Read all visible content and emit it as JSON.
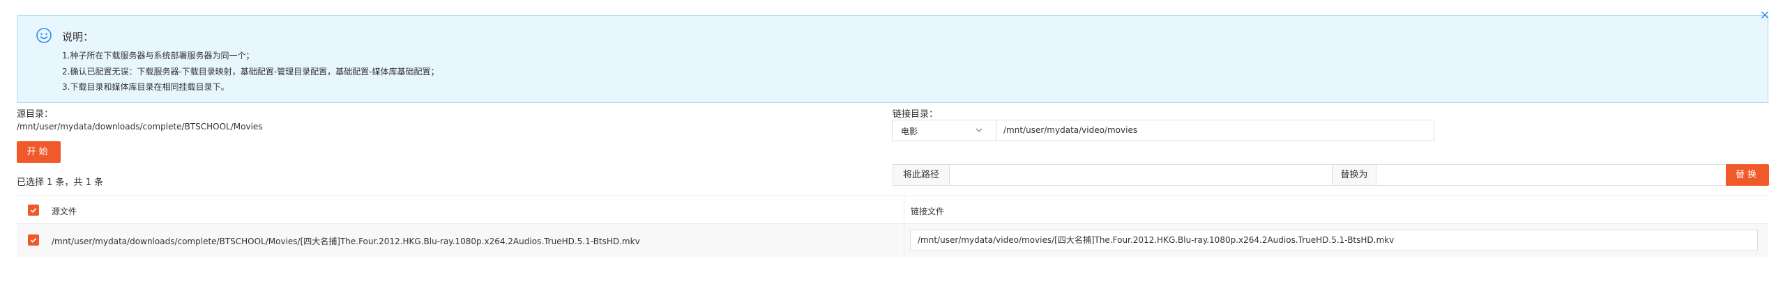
{
  "notice": {
    "title": "说明：",
    "lines": [
      "1.种子所在下载服务器与系统部署服务器为同一个；",
      "2.确认已配置无误：下载服务器-下载目录映射，基础配置-管理目录配置，基础配置-媒体库基础配置；",
      "3.下载目录和媒体库目录在相同挂载目录下。"
    ],
    "close_glyph": "×",
    "icon": "smile-icon",
    "accent_color": "#2d8cf0"
  },
  "source": {
    "label": "源目录：",
    "path": "/mnt/user/mydata/downloads/complete/BTSCHOOL/Movies"
  },
  "start_button": "开始",
  "selection_summary": "已选择 1 条，共 1 条",
  "link": {
    "label": "链接目录：",
    "type_selected": "电影",
    "path": "/mnt/user/mydata/video/movies"
  },
  "replace": {
    "path_label": "将此路径",
    "path_value": "",
    "replace_label": "替换为",
    "replace_value": "",
    "button": "替换"
  },
  "table": {
    "headers": [
      "源文件",
      "链接文件"
    ],
    "rows": [
      {
        "checked": true,
        "source": "/mnt/user/mydata/downloads/complete/BTSCHOOL/Movies/[四大名捕]The.Four.2012.HKG.Blu-ray.1080p.x264.2Audios.TrueHD.5.1-BtsHD.mkv",
        "link": "/mnt/user/mydata/video/movies/[四大名捕]The.Four.2012.HKG.Blu-ray.1080p.x264.2Audios.TrueHD.5.1-BtsHD.mkv"
      }
    ],
    "header_checked": true
  },
  "colors": {
    "primary": "#f05a2a",
    "notice_bg": "#e8f6fd",
    "notice_border": "#a9d8f0"
  }
}
